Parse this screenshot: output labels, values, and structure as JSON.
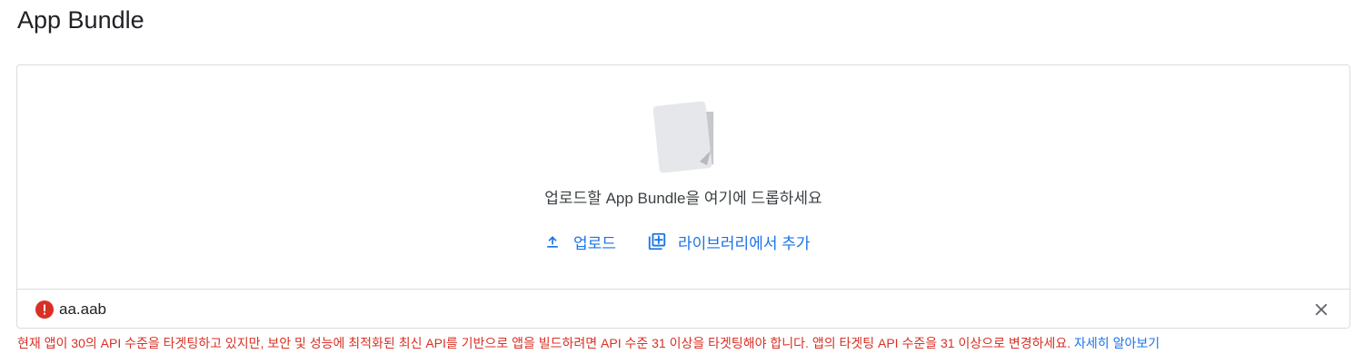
{
  "header": {
    "title": "App Bundle"
  },
  "dropzone": {
    "illustration_icon": "document-stack-icon",
    "instruction": "업로드할 App Bundle을 여기에 드롭하세요",
    "upload_label": "업로드",
    "upload_icon": "upload-icon",
    "library_label": "라이브러리에서 추가",
    "library_icon": "library-add-icon"
  },
  "file": {
    "name": "aa.aab",
    "status_icon": "error-icon",
    "remove_icon": "close-icon"
  },
  "error": {
    "message": "현재 앱이 30의 API 수준을 타겟팅하고 있지만, 보안 및 성능에 최적화된 최신 API를 기반으로 앱을 빌드하려면 API 수준 31 이상을 타겟팅해야 합니다. 앱의 타겟팅 API 수준을 31 이상으로 변경하세요.",
    "learn_more": "자세히 알아보기"
  },
  "colors": {
    "link": "#1a73e8",
    "error": "#d93025",
    "border": "#dadce0",
    "text": "#202124"
  }
}
